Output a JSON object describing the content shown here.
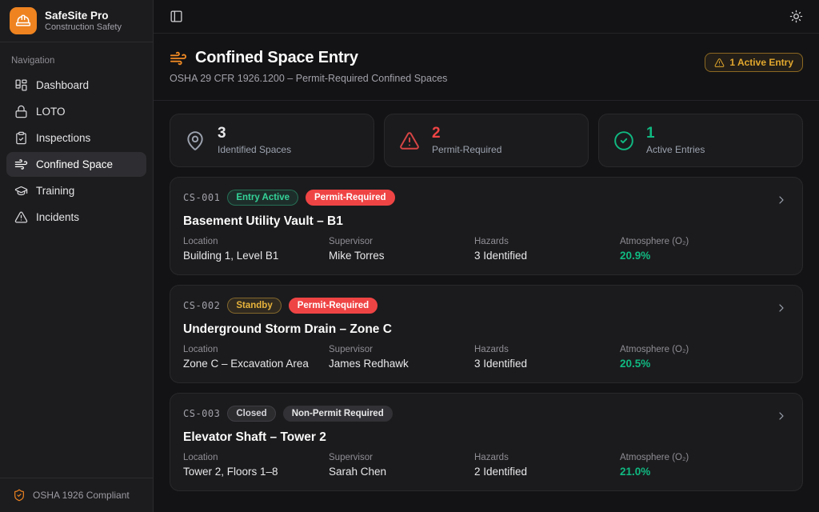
{
  "app": {
    "name": "SafeSite Pro",
    "tagline": "Construction Safety"
  },
  "sidebar": {
    "nav_label": "Navigation",
    "items": [
      {
        "label": "Dashboard",
        "icon": "dashboard-grid-icon",
        "active": false
      },
      {
        "label": "LOTO",
        "icon": "lock-icon",
        "active": false
      },
      {
        "label": "Inspections",
        "icon": "clipboard-check-icon",
        "active": false
      },
      {
        "label": "Confined Space",
        "icon": "wind-icon",
        "active": true
      },
      {
        "label": "Training",
        "icon": "graduation-cap-icon",
        "active": false
      },
      {
        "label": "Incidents",
        "icon": "alert-triangle-icon",
        "active": false
      }
    ],
    "footer": "OSHA 1926 Compliant"
  },
  "header": {
    "title": "Confined Space Entry",
    "subtitle": "OSHA 29 CFR 1926.1200 – Permit-Required Confined Spaces",
    "active_entry_badge": "1 Active Entry"
  },
  "stats": [
    {
      "value": "3",
      "label": "Identified Spaces",
      "icon": "map-pin-icon",
      "color": "#e8e8ea"
    },
    {
      "value": "2",
      "label": "Permit-Required",
      "icon": "alert-triangle-icon",
      "color": "#ef4444"
    },
    {
      "value": "1",
      "label": "Active Entries",
      "icon": "check-circle-icon",
      "color": "#10b981"
    }
  ],
  "spaces": [
    {
      "code": "CS-001",
      "status": "Entry Active",
      "permit": "Permit-Required",
      "title": "Basement Utility Vault – B1",
      "fields": [
        {
          "label": "Location",
          "value": "Building 1, Level B1"
        },
        {
          "label": "Supervisor",
          "value": "Mike Torres"
        },
        {
          "label": "Hazards",
          "value": "3 Identified"
        },
        {
          "label": "Atmosphere (O₂)",
          "value": "20.9%"
        }
      ]
    },
    {
      "code": "CS-002",
      "status": "Standby",
      "permit": "Permit-Required",
      "title": "Underground Storm Drain – Zone C",
      "fields": [
        {
          "label": "Location",
          "value": "Zone C – Excavation Area"
        },
        {
          "label": "Supervisor",
          "value": "James Redhawk"
        },
        {
          "label": "Hazards",
          "value": "3 Identified"
        },
        {
          "label": "Atmosphere (O₂)",
          "value": "20.5%"
        }
      ]
    },
    {
      "code": "CS-003",
      "status": "Closed",
      "permit": "Non-Permit Required",
      "title": "Elevator Shaft – Tower 2",
      "fields": [
        {
          "label": "Location",
          "value": "Tower 2, Floors 1–8"
        },
        {
          "label": "Supervisor",
          "value": "Sarah Chen"
        },
        {
          "label": "Hazards",
          "value": "2 Identified"
        },
        {
          "label": "Atmosphere (O₂)",
          "value": "21.0%"
        }
      ]
    }
  ],
  "colors": {
    "accent": "#ee8320",
    "green": "#10b981",
    "red": "#ef4444",
    "amber": "#e3a82e"
  }
}
